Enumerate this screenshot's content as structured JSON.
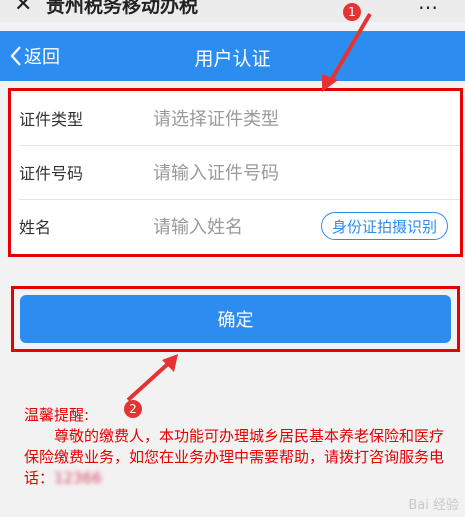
{
  "topbar": {
    "close_glyph": "✕",
    "title": "贵州税务移动办税",
    "more_glyph": "…"
  },
  "navbar": {
    "back_label": "返回",
    "title": "用户认证"
  },
  "form": {
    "rows": [
      {
        "label": "证件类型",
        "placeholder": "请选择证件类型"
      },
      {
        "label": "证件号码",
        "placeholder": "请输入证件号码"
      },
      {
        "label": "姓名",
        "placeholder": "请输入姓名"
      }
    ],
    "ocr_button": "身份证拍摄识别"
  },
  "confirm_label": "确定",
  "tips": {
    "heading": "温馨提醒:",
    "body": "尊敬的缴费人，本功能可办理城乡居民基本养老保险和医疗保险缴费业务，如您在业务办理中需要帮助，请拨打咨询服务电话：",
    "phone": "12366"
  },
  "markers": [
    "1",
    "2"
  ],
  "watermark": "Bai 经验",
  "colors": {
    "accent": "#2d8cf0",
    "annotation_red": "#e60000"
  }
}
